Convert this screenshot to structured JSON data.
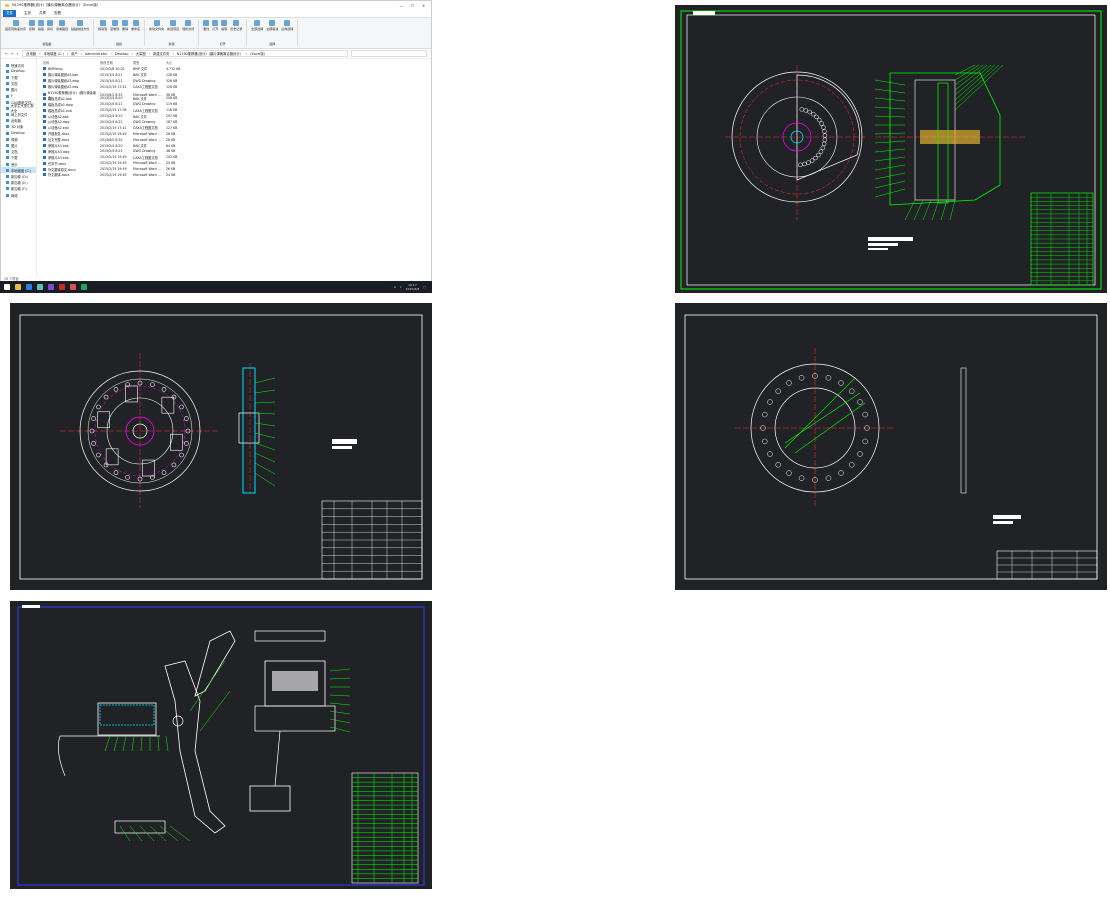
{
  "explorer": {
    "title": "N1190推荐器(设计)（膜片弹簧离合器设计）（Excel版）",
    "window_controls": [
      "—",
      "☐",
      "✕"
    ],
    "menu_tabs": [
      "文件",
      "主页",
      "共享",
      "查看"
    ],
    "ribbon_groups": [
      {
        "label": "剪贴板",
        "buttons": [
          "固定到快速访问",
          "复制",
          "粘贴",
          "剪切",
          "复制路径",
          "粘贴快捷方式"
        ]
      },
      {
        "label": "组织",
        "buttons": [
          "移动到",
          "复制到",
          "删除",
          "重命名"
        ]
      },
      {
        "label": "新建",
        "buttons": [
          "新建文件夹",
          "新建项目",
          "轻松访问"
        ]
      },
      {
        "label": "打开",
        "buttons": [
          "属性",
          "打开",
          "编辑",
          "历史记录"
        ]
      },
      {
        "label": "选择",
        "buttons": [
          "全部选择",
          "全部取消",
          "反向选择"
        ]
      }
    ],
    "breadcrumb": [
      "此电脑",
      "本地磁盘 (C:)",
      "用户",
      "Administrator",
      "Desktop",
      "大量图",
      "新建文件夹",
      "N1190推荐器(设计)（膜片弹簧离合器设计）",
      "(Excel版)"
    ],
    "search_placeholder": "",
    "nav_items": [
      "快速访问",
      "Desktop",
      "下载",
      "文档",
      "图片",
      "F",
      "CAD图纸文件...",
      "大学生大型汇报大全",
      "网上邻文件",
      "此电脑",
      "3D 对象",
      "Desktop",
      "视频",
      "图片",
      "文档",
      "下载",
      "音乐",
      "本地磁盘 (C:)",
      "新加卷 (D:)",
      "新加卷 (E:)",
      "新加卷 (F:)",
      "网络"
    ],
    "columns": [
      "名称",
      "修改日期",
      "类型",
      "大小"
    ],
    "files": [
      [
        "BMP.bmp",
        "2015/2/8 10:02",
        "BMP 文件",
        "4,712 KB"
      ],
      [
        "膜片弹簧图纸A3.bak",
        "2015/3/4 8:21",
        "BAK 文件",
        "128 KB"
      ],
      [
        "膜片弹簧图纸A3.dwg",
        "2015/3/4 8:21",
        "DWG Drawing",
        "526 KB"
      ],
      [
        "膜片弹簧图纸A3.exb",
        "2015/2/19 17:41",
        "CAXA工程图文档",
        "126 KB"
      ],
      [
        "N1190推荐器(设计)（膜片弹簧离合...",
        "2015/6/2 8:35",
        "Microsoft Word ...",
        "36 KB"
      ],
      [
        "踏板总成A1.bak",
        "2015/2/4 8:20",
        "BAK 文件",
        "208 KB"
      ],
      [
        "踏板总成A1.dwg",
        "2015/2/4 8:21",
        "DWG Drawing",
        "119 KB"
      ],
      [
        "踏板总成A1.exb",
        "2015/2/19 17:36",
        "CAXA工程图文档",
        "118 KB"
      ],
      [
        "从动盘A2.bak",
        "2015/2/4 8:20",
        "BAK 文件",
        "297 KB"
      ],
      [
        "从动盘A2.dwg",
        "2015/2/4 8:22",
        "DWG Drawing",
        "187 KB"
      ],
      [
        "从动盘A2.exb",
        "2015/2/19 17:41",
        "CAXA工程图文档",
        "127 KB"
      ],
      [
        "开题报告.docx",
        "2015/2/19 19:49",
        "Microsoft Word ...",
        "26 KB"
      ],
      [
        "论文完整.docx",
        "2015/6/2 8:35",
        "Microsoft Word ...",
        "28 KB"
      ],
      [
        "摩擦片A3.bak",
        "2015/2/4 8:20",
        "BAK 文件",
        "84 KB"
      ],
      [
        "摩擦片A3.dwg",
        "2015/2/4 8:22",
        "DWG Drawing",
        "48 KB"
      ],
      [
        "摩擦片A3.exb",
        "2015/2/19 19:49",
        "CAXA工程图文档",
        "102 KB"
      ],
      [
        "任务书.docx",
        "2015/2/19 19:49",
        "Microsoft Word ...",
        "25 KB"
      ],
      [
        "外文翻译原文.docx",
        "2015/2/19 19:49",
        "Microsoft Word ...",
        "26 KB"
      ],
      [
        "外文翻译.docx",
        "2015/2/19 19:49",
        "Microsoft Word ...",
        "24 KB"
      ]
    ],
    "status": "19 个项目",
    "clock": {
      "time": "10:17",
      "date": "2015/6/8"
    }
  },
  "taskbar_icons": [
    "windows-start",
    "file-explorer",
    "browser",
    "notepad",
    "visual-studio",
    "cad-app",
    "media",
    "excel"
  ],
  "colors": {
    "cad_bg": "#212226",
    "cad_line": "#00ff00",
    "cad_white": "#ffffff",
    "cad_red": "#ff3030",
    "cad_magenta": "#ff00ff",
    "cad_cyan": "#00e0ff",
    "accent": "#1a73c8"
  }
}
